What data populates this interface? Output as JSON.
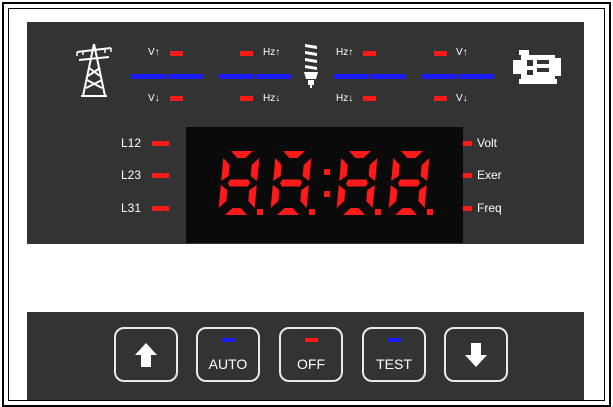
{
  "status_panel": {
    "volt_up": "V↑",
    "volt_down": "V↓",
    "hz_up": "Hz↑",
    "hz_down": "Hz↓",
    "line_labels": [
      "L12",
      "L23",
      "L31"
    ],
    "mode_labels": [
      "Volt",
      "Exer",
      "Freq"
    ]
  },
  "display": {
    "digits": [
      "8",
      "8",
      "8",
      "8"
    ],
    "color": "#ff1a1a"
  },
  "keypad": {
    "up_icon": "arrow-up-icon",
    "auto_label": "AUTO",
    "off_label": "OFF",
    "test_label": "TEST",
    "down_icon": "arrow-down-icon",
    "auto_led_color": "#1a1aff",
    "off_led_color": "#ff1a1a",
    "test_led_color": "#1a1aff"
  },
  "icons": {
    "utility": "transmission-tower-icon",
    "load": "light-bulb-icon",
    "generator": "generator-icon"
  }
}
